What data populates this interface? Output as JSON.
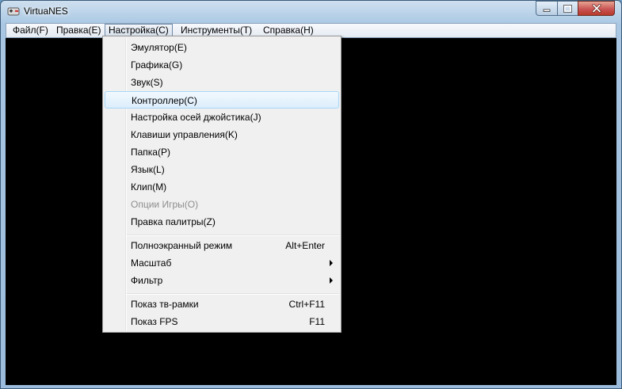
{
  "window": {
    "title": "VirtuaNES",
    "icon": "nes-controller-icon"
  },
  "title_buttons": [
    "minimize-icon",
    "maximize-icon",
    "close-icon"
  ],
  "menubar": {
    "items": [
      {
        "label": "Файл(F)"
      },
      {
        "label": "Правка(E)"
      },
      {
        "label": "Настройка(C)"
      },
      {
        "label": "Инструменты(T)"
      },
      {
        "label": "Справка(H)"
      }
    ],
    "active_index": 2
  },
  "settings_menu": {
    "items": [
      {
        "label": "Эмулятор(E)",
        "shortcut": ""
      },
      {
        "label": "Графика(G)",
        "shortcut": ""
      },
      {
        "label": "Звук(S)",
        "shortcut": ""
      },
      {
        "label": "Контроллер(C)",
        "shortcut": "",
        "highlighted": true
      },
      {
        "label": "Настройка осей джойстика(J)",
        "shortcut": ""
      },
      {
        "label": "Клавиши управления(K)",
        "shortcut": ""
      },
      {
        "label": "Папка(P)",
        "shortcut": ""
      },
      {
        "label": "Язык(L)",
        "shortcut": ""
      },
      {
        "label": "Клип(M)",
        "shortcut": ""
      },
      {
        "label": "Опции Игры(O)",
        "shortcut": "",
        "disabled": true
      },
      {
        "label": "Правка палитры(Z)",
        "shortcut": ""
      },
      {
        "label": "Полноэкранный режим",
        "shortcut": "Alt+Enter"
      },
      {
        "label": "Масштаб",
        "shortcut": "",
        "submenu": true
      },
      {
        "label": "Фильтр",
        "shortcut": "",
        "submenu": true
      },
      {
        "label": "Показ тв-рамки",
        "shortcut": "Ctrl+F11"
      },
      {
        "label": "Показ FPS",
        "shortcut": "F11"
      }
    ]
  },
  "colors": {
    "client_background": "#000000",
    "menu_background": "#f0f0f0",
    "highlight_border": "#a8d8f7",
    "disabled_text": "#8d8d8d"
  }
}
